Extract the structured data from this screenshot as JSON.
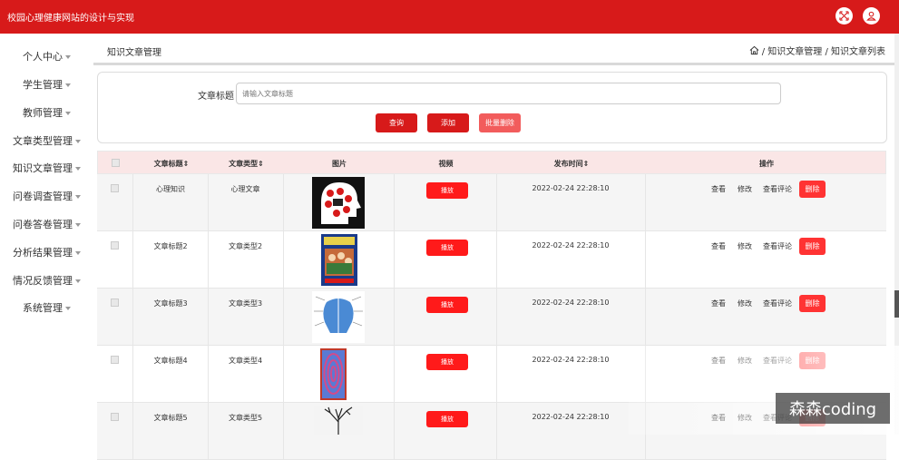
{
  "app": {
    "title": "校园心理健康网站的设计与实现"
  },
  "sidebar": {
    "items": [
      {
        "label": "个人中心"
      },
      {
        "label": "学生管理"
      },
      {
        "label": "教师管理"
      },
      {
        "label": "文章类型管理"
      },
      {
        "label": "知识文章管理"
      },
      {
        "label": "问卷调查管理"
      },
      {
        "label": "问卷答卷管理"
      },
      {
        "label": "分析结果管理"
      },
      {
        "label": "情况反馈管理"
      },
      {
        "label": "系统管理"
      }
    ]
  },
  "header": {
    "page_title": "知识文章管理",
    "breadcrumb": "/ 知识文章管理 / 知识文章列表"
  },
  "search": {
    "label": "文章标题",
    "placeholder": "请输入文章标题",
    "query_btn": "查询",
    "add_btn": "添加",
    "batch_delete_btn": "批量删除"
  },
  "table": {
    "headers": [
      "文章标题",
      "文章类型",
      "图片",
      "视频",
      "发布时间",
      "操作"
    ],
    "sort_marks": [
      "⇕",
      "⇕",
      "",
      "",
      "⇕",
      ""
    ],
    "rows": [
      {
        "title": "心理知识",
        "type": "心理文章",
        "image": "thumb-brain",
        "play": "播放",
        "time": "2022-02-24 22:28:10"
      },
      {
        "title": "文章标题2",
        "type": "文章类型2",
        "image": "thumb-book",
        "play": "播放",
        "time": "2022-02-24 22:28:10"
      },
      {
        "title": "文章标题3",
        "type": "文章类型3",
        "image": "thumb-head-diagram",
        "play": "播放",
        "time": "2022-02-24 22:28:10"
      },
      {
        "title": "文章标题4",
        "type": "文章类型4",
        "image": "thumb-illusion",
        "play": "播放",
        "time": "2022-02-24 22:28:10"
      },
      {
        "title": "文章标题5",
        "type": "文章类型5",
        "image": "thumb-tree",
        "play": "播放",
        "time": "2022-02-24 22:28:10"
      }
    ],
    "ops": {
      "view": "查看",
      "edit": "修改",
      "comments": "查看评论",
      "delete": "删除"
    }
  },
  "watermark": "森森coding",
  "colors": {
    "primary": "#d71a1a",
    "header_bg": "#fae6e6",
    "play": "#ff1a1a",
    "delete": "#ff3333"
  }
}
